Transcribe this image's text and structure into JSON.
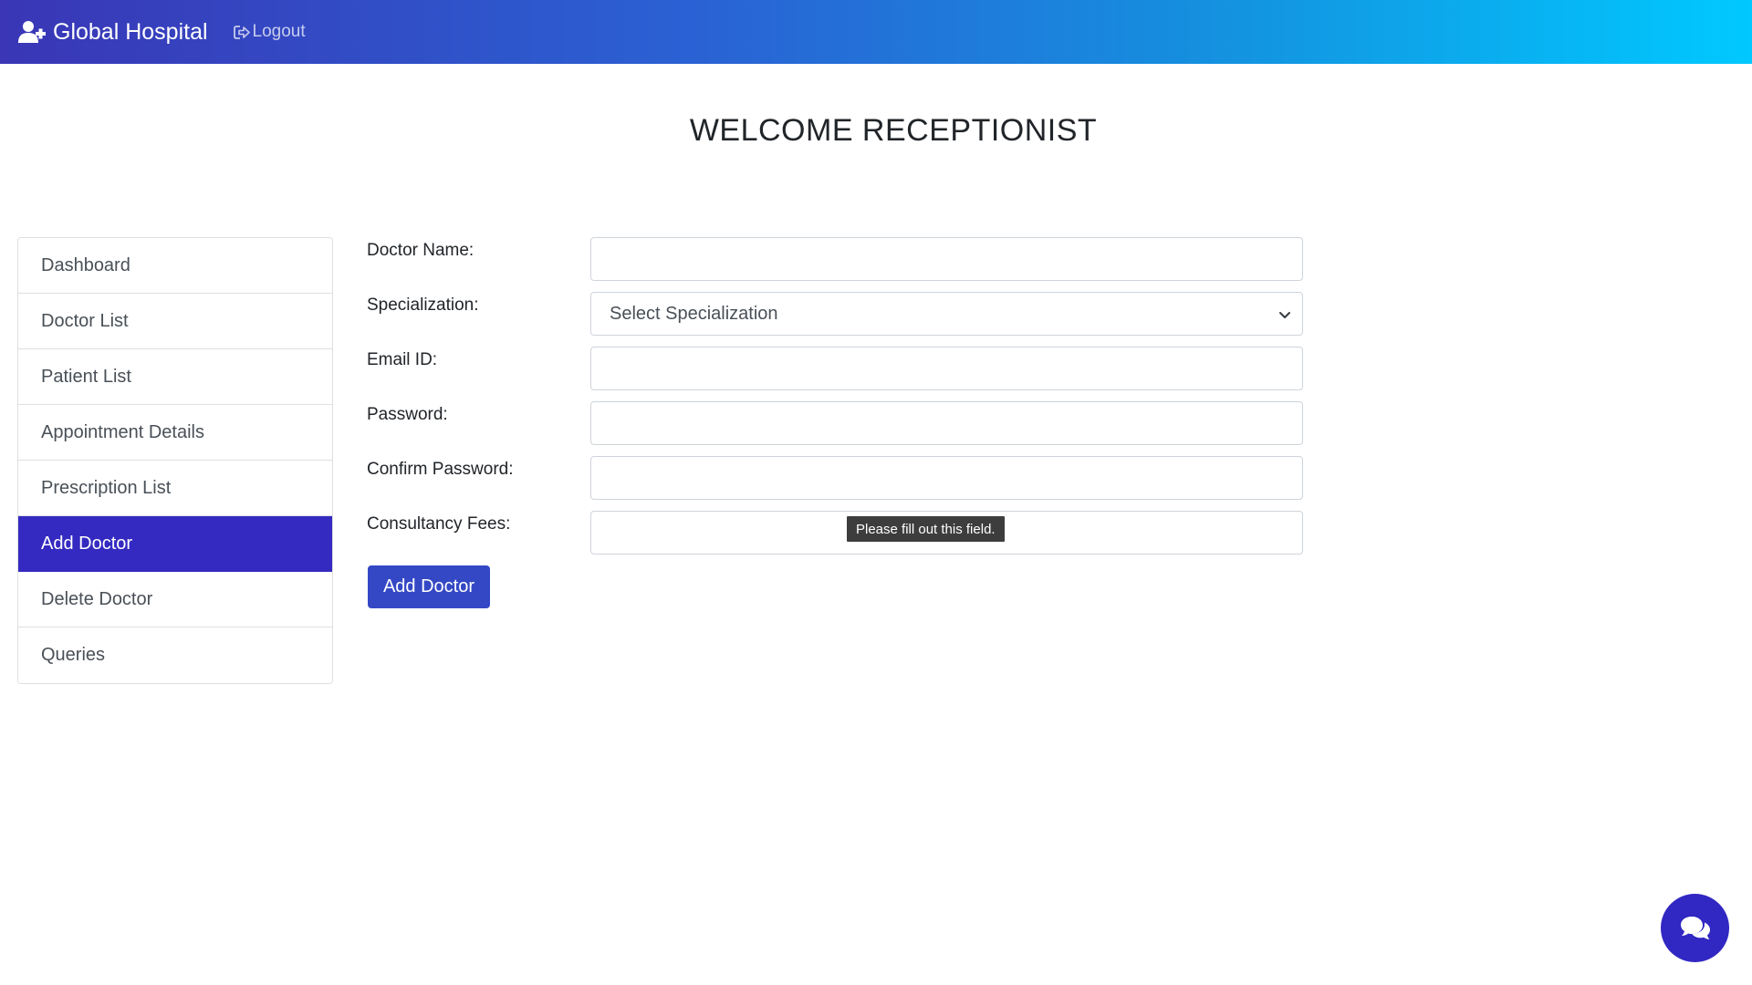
{
  "navbar": {
    "brand": "Global Hospital",
    "brand_icon": "user-plus-icon",
    "logout_label": "Logout",
    "logout_icon": "sign-out-icon",
    "gradient_start": "#3a36b6",
    "gradient_end": "#00c9ff"
  },
  "welcome": "WELCOME RECEPTIONIST",
  "sidebar": {
    "active_color": "#342ac1",
    "items": [
      {
        "label": "Dashboard",
        "active": false
      },
      {
        "label": "Doctor List",
        "active": false
      },
      {
        "label": "Patient List",
        "active": false
      },
      {
        "label": "Appointment Details",
        "active": false
      },
      {
        "label": "Prescription List",
        "active": false
      },
      {
        "label": "Add Doctor",
        "active": true
      },
      {
        "label": "Delete Doctor",
        "active": false
      },
      {
        "label": "Queries",
        "active": false
      }
    ]
  },
  "form": {
    "doctor_name": {
      "label": "Doctor Name:",
      "value": ""
    },
    "specialization": {
      "label": "Specialization:",
      "selected": "Select Specialization"
    },
    "email": {
      "label": "Email ID:",
      "value": ""
    },
    "password": {
      "label": "Password:",
      "value": ""
    },
    "confirm_password": {
      "label": "Confirm Password:",
      "value": ""
    },
    "fees": {
      "label": "Consultancy Fees:",
      "value": ""
    },
    "validation_tooltip": "Please fill out this field.",
    "submit_label": "Add Doctor",
    "submit_color": "#3448c5"
  },
  "chat": {
    "icon": "comments-icon",
    "color": "#3127c2"
  }
}
